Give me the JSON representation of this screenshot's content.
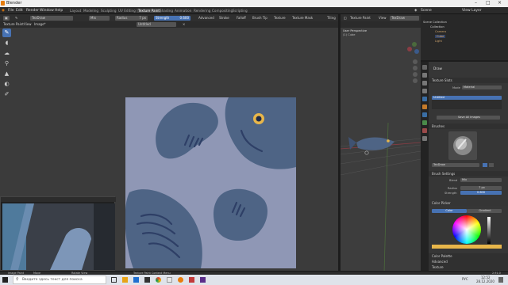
{
  "window": {
    "title": "Blender"
  },
  "menu": [
    "File",
    "Edit",
    "Render",
    "Window",
    "Help"
  ],
  "workspaces": [
    "Layout",
    "Modeling",
    "Sculpting",
    "UV Editing",
    "Texture Paint",
    "Shading",
    "Animation",
    "Rendering",
    "Compositing",
    "Scripting"
  ],
  "scene_label": "Scene",
  "view_layer_label": "View Layer",
  "tool_header": {
    "mode": "Texture Paint",
    "brush": "TexDraw",
    "blend": "Mix",
    "radius_label": "Radius",
    "radius_value": "7 px",
    "strength_label": "Strength",
    "strength_value": "0.600",
    "advanced": "Advanced",
    "stroke": "Stroke",
    "falloff": "Falloff",
    "brush_tip": "Brush Tip",
    "texture": "Texture",
    "texture_mask": "Texture Mask",
    "tiling": "Tiling"
  },
  "image_editor": {
    "view": "View",
    "image": "Image*",
    "image_name": "Untitled"
  },
  "viewport": {
    "mode": "Texture Paint",
    "view": "View",
    "title": "User Perspective",
    "object": "(1) Cube",
    "brush": "TexDraw"
  },
  "outliner": {
    "items": [
      "Scene Collection",
      "Collection",
      "Camera",
      "Cube",
      "Light"
    ]
  },
  "properties": {
    "brush_name": "Draw",
    "texture_slots": "Texture Slots",
    "mode_label": "Mode",
    "mode_value": "Material",
    "slot_item": "Untitled",
    "save_all": "Save All Images",
    "brushes": "Brushes",
    "brush_field": "TexDraw",
    "brush_settings": "Brush Settings",
    "blend_label": "Blend",
    "blend_value": "Mix",
    "radius_label": "Radius",
    "radius_value": "7 px",
    "strength_label": "Strength",
    "strength_value": "0.600",
    "color_picker": "Color Picker",
    "tab_color": "Color",
    "tab_gradient": "Gradient",
    "color_palette": "Color Palette",
    "advanced": "Advanced",
    "texture": "Texture"
  },
  "status": {
    "left": "Image Paint",
    "middle": "Move",
    "rotate": "Rotate View",
    "context": "Texture Paint Context Menu",
    "version": "2.91.0"
  },
  "taskbar": {
    "search_placeholder": "Введите здесь текст для поиска",
    "time": "12:52",
    "date": "28.12.2020",
    "lang": "РУС"
  },
  "colors": {
    "accent": "#4772b3",
    "canvas_bg": "#8f97b5",
    "paint": "#4e6485",
    "stroke": "#2e3f66",
    "eye": "#e8b64a"
  }
}
